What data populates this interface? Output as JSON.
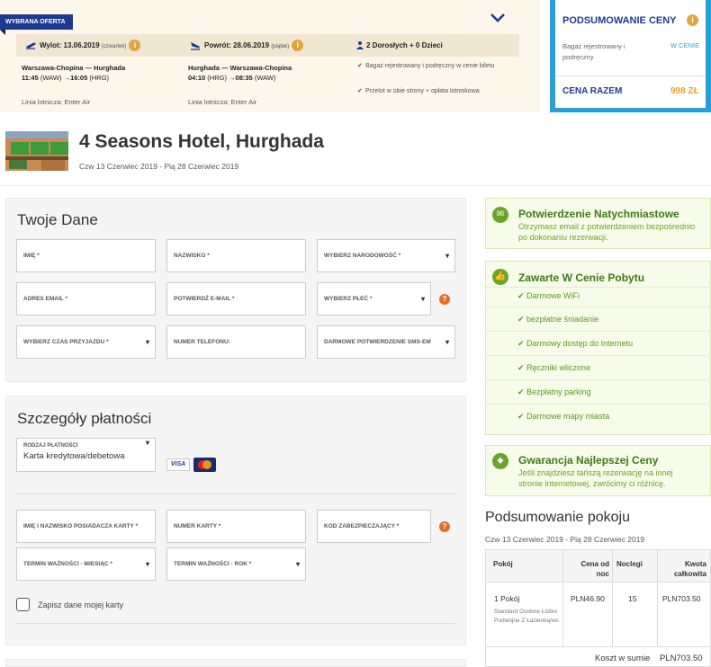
{
  "offer": {
    "badge": "WYBRANA OFERTA",
    "outbound_label": "Wylot: 13.06.2019",
    "outbound_day": "(czwartek)",
    "return_label": "Powrót: 28.06.2019",
    "return_day": "(piątek)",
    "passengers": "2 Dorosłych + 0 Dzieci",
    "outbound_route": "Warszawa-Chopina — Hurghada",
    "outbound_time_dep": "11:45",
    "outbound_code_dep": "(WAW)",
    "outbound_time_arr": "16:05",
    "outbound_code_arr": "(HRG)",
    "return_route": "Hurghada — Warszawa-Chopina",
    "return_time_dep": "04:10",
    "return_code_dep": "(HRG)",
    "return_time_arr": "08:35",
    "return_code_arr": "(WAW)",
    "included_1": "Bagaż rejestrowany i podręczny w cenie biletu",
    "included_2": "Przelot w obie strony + opłata lotniskowa",
    "airline_out": "Linia lotnicza: Enter Air",
    "airline_ret": "Linia lotnicza: Enter Air",
    "arrow": "→"
  },
  "price_summary": {
    "title": "PODSUMOWANIE CENY",
    "luggage_label": "Bagaż rejestrowany i podręczny",
    "luggage_value": "W CENIE",
    "total_label": "CENA RAZEM",
    "total_value": "998 ZŁ"
  },
  "hotel": {
    "name": "4 Seasons Hotel, Hurghada",
    "dates": "Czw 13 Czerwiec 2019 - Pią 28 Czerwiec 2019"
  },
  "personal": {
    "title": "Twoje Dane",
    "first_name": "IMIĘ *",
    "last_name": "NAZWISKO *",
    "nationality": "WYBIERZ NARODOWOŚĆ *",
    "email": "ADRES EMAIL *",
    "email_confirm": "POTWIERDŹ E-MAIL *",
    "gender": "WYBIERZ PŁEĆ *",
    "arrival_time": "WYBIERZ CZAS PRZYJAZDU *",
    "phone": "NUMER TELEFONU:",
    "sms": "DARMOWE POTWIERDZENIE SMS-EM"
  },
  "payment": {
    "title": "Szczegóły płatności",
    "type_label": "RODZAJ PŁATNOŚCI",
    "type_value": "Karta kredytowa/debetowa",
    "visa": "VISA",
    "holder": "IMIĘ I NAZWISKO POSIADACZA KARTY *",
    "card_number": "NUMER KARTY *",
    "cvv": "KOD ZABEZPIECZAJĄCY *",
    "exp_month": "TERMIN WAŻNOŚCI - MIESIĄC *",
    "exp_year": "TERMIN WAŻNOŚCI - ROK *",
    "save_card": "Zapisz dane mojej karty"
  },
  "confirm_box": {
    "title": "Potwierdzenie Natychmiastowe",
    "text": "Otrzymasz email z potwierdzeniem bezpośrednio po dokonaniu rezerwacji."
  },
  "included_box": {
    "title": "Zawarte W Cenie Pobytu",
    "items": [
      "Darmowe WiFi",
      "bezpłatne śniadanie",
      "Darmowy dostęp do Internetu",
      "Ręczniki wliczone",
      "Bezpłatny parking",
      "Darmowe mapy miasta"
    ]
  },
  "guarantee_box": {
    "title": "Gwarancja Najlepszej Ceny",
    "text": "Jeśli znajdziesz tańszą rezerwację na innej stronie internetowej, zwrócimy ci różnicę."
  },
  "room_summary": {
    "title": "Podsumowanie pokoju",
    "dates": "Czw 13 Czerwiec 2019 - Pią 28 Czerwiec 2019",
    "col_room": "Pokój",
    "col_price_a": "Cena od",
    "col_price_b": "noc",
    "col_nights": "Noclegi",
    "col_total_a": "Kwota",
    "col_total_b": "całkowita",
    "room": "1 Pokój",
    "room_desc": "Standard Osobne Łóżko Podwójne Z Łazienką/wc",
    "price": "PLN46.90",
    "nights": "15",
    "total": "PLN703.50",
    "sum_label": "Koszt w sumie",
    "sum_value": "PLN703.50"
  },
  "colors": {
    "accent_blue": "#1d3a8f",
    "summary_border": "#2a9fd6",
    "total_orange": "#e8a030",
    "green": "#6aa52a"
  }
}
